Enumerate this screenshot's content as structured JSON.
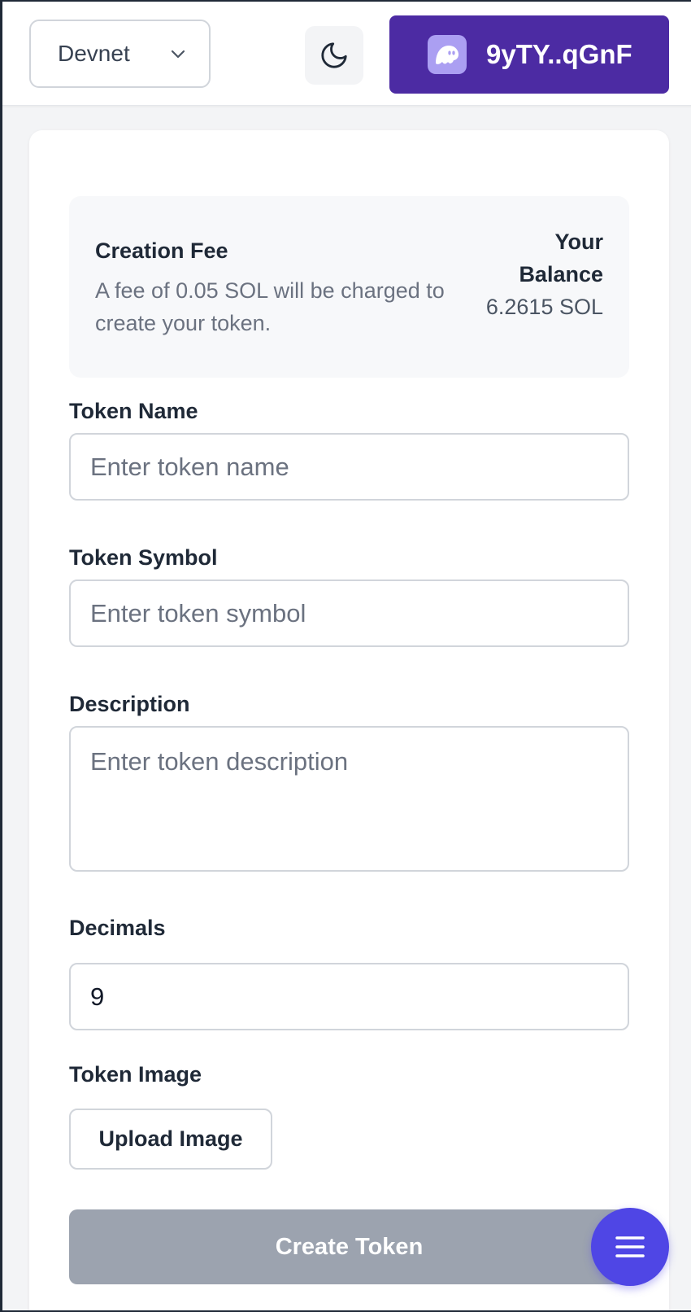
{
  "header": {
    "network": "Devnet",
    "wallet_address": "9yTY..qGnF",
    "icons": {
      "network_dropdown": "chevron-down-icon",
      "theme": "moon-icon",
      "wallet": "phantom-icon"
    }
  },
  "fee": {
    "title": "Creation Fee",
    "description": "A fee of 0.05 SOL will be charged to create your token.",
    "balance_label": "Your Balance",
    "balance_value": "6.2615 SOL"
  },
  "form": {
    "token_name_label": "Token Name",
    "token_name_placeholder": "Enter token name",
    "token_symbol_label": "Token Symbol",
    "token_symbol_placeholder": "Enter token symbol",
    "description_label": "Description",
    "description_placeholder": "Enter token description",
    "decimals_label": "Decimals",
    "decimals_value": "9",
    "image_label": "Token Image",
    "upload_label": "Upload Image",
    "submit_label": "Create Token"
  },
  "fab": {
    "icon": "menu-icon"
  },
  "colors": {
    "wallet_bg": "#4c2ba3",
    "phantom_icon": "#ab9ff2",
    "submit_disabled": "#9ca3af",
    "fab_bg": "#4f46e5"
  }
}
